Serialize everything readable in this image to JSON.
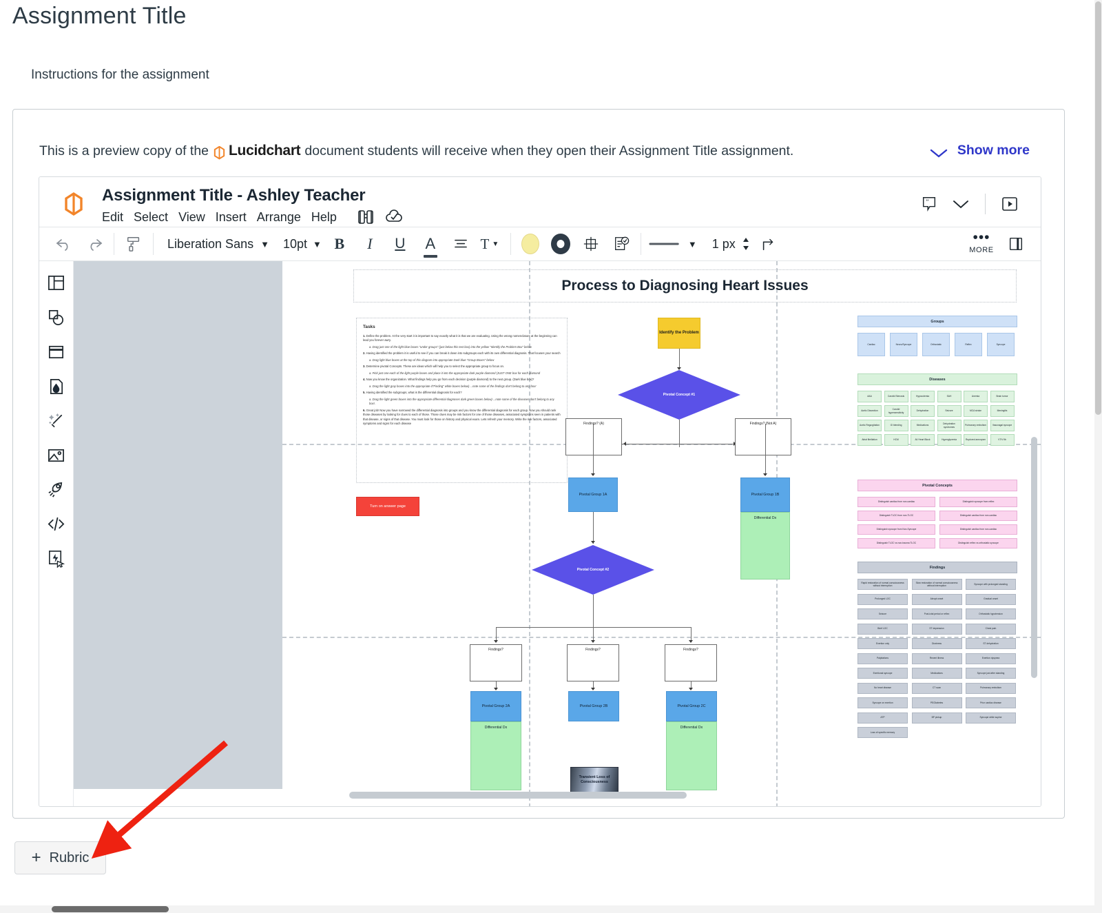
{
  "page": {
    "title": "Assignment Title",
    "instructions": "Instructions for the assignment"
  },
  "preview_banner": {
    "text_before": "This is a preview copy of the",
    "brand": "Lucidchart",
    "text_after": "document students will receive when they open their Assignment Title assignment.",
    "show_more_label": "Show more",
    "link_color": "#2f37c9"
  },
  "lucid_app": {
    "document_title": "Assignment Title - Ashley Teacher",
    "menus": [
      "Edit",
      "Select",
      "View",
      "Insert",
      "Arrange",
      "Help"
    ],
    "menu_icons": [
      "binoculars-icon",
      "cloud-check-icon"
    ],
    "header_right_icons": [
      "comment-icon",
      "chevron-down-icon",
      "present-icon"
    ],
    "toolbar": {
      "undo_icon": "undo-icon",
      "redo_icon": "redo-icon",
      "format_painter_icon": "paint-roller-icon",
      "font_family": "Liberation Sans",
      "font_size": "10pt",
      "bold": "B",
      "italic": "I",
      "underline": "U",
      "font_color": "A",
      "align_icon": "align-icon",
      "text_options": "T",
      "fill_swatch_color": "#f5eda0",
      "border_swatch_color": "#2f3b47",
      "shape_icon": "shape-bounds-icon",
      "notes_icon": "notes-check-icon",
      "line_style": "line-style-icon",
      "line_width": "1 px",
      "line_route_icon": "elbow-connector-icon",
      "more_dots": "•••",
      "more_label": "MORE",
      "panel_icon": "right-panel-icon"
    },
    "sidebar_icons": [
      "layout-panel-icon",
      "shapes-icon",
      "container-icon",
      "ink-document-icon",
      "magic-wand-icon",
      "image-icon",
      "rocket-icon",
      "code-icon",
      "quick-action-icon"
    ]
  },
  "diagram": {
    "title": "Process to Diagnosing Heart Issues",
    "tasks": {
      "heading": "Tasks",
      "items": [
        {
          "n": "1.",
          "text": "Define the problem.  At the very start it is important to say exactly what it is that we are evaluating. Using the wrong nomenclature at the beginning can lead you forever awry.",
          "sub": "a. Drag just one of the light blue boxes \"under groups\" (just below this text box) into the yellow \"Identify the Problem Box\" below"
        },
        {
          "n": "2.",
          "text": "Having identified the problem it is useful to see if you can break it down into subgroups each with its own differential diagnosis. That focuses your search",
          "sub": "a. Drag light blue boxes at the top of this diagram into appropriate  Dark blue \"Group Boxes\" below"
        },
        {
          "n": "3.",
          "text": "Determine pivotal Concepts.  These are ideas which will help you to select the appropriate group to focus on.",
          "sub": "a. Pick just one each of the light purple boxes and place it into the appropriate dark purple diamond (JUST ONE box for each diamond"
        },
        {
          "n": "4.",
          "text": "Now you know the organization. What findings help you go from each decision (purple diamond) to the next group. (Dark blue box)?",
          "sub": "a. Drag the light gray boxes into the appropriate d\"Finding\" white boxes below) ...note some of the findings don't belong to any box!"
        },
        {
          "n": "5.",
          "text": "Having identified the subgroups, what is the differential diagnosis for each?",
          "sub": "a. Drag the light green boxes into the appropriate differential diagnoses dark green boxes below) ...note some of the diseases don't belong to any box!."
        },
        {
          "n": "6.",
          "text": "Great job! Now you have narrowed the differential diagnosis into groups and you know the differential diagnosis for each group. Now you should rank those diseases by looking for clues to each of those. Those clues may be risk factors for one of those diseases, associated symptoms seen in patients with that disease, or signs of that disease. You must look for those on history and physical exam. Lets refresh your memory. Write the risk factors, associated symptoms and signs for each disease",
          "sub": ""
        }
      ]
    },
    "answer_button": "Turn on answer page",
    "nodes": {
      "identify": "Identify the Problem",
      "pivotal_concept_1": "Pivotal Concept #1",
      "pivotal_concept_2": "Pivotal Concept #2",
      "findings_yes": "Findings? (A)",
      "findings_no": "Findings? (Not A)",
      "findings_q": "Findings?",
      "group_1a": "Pivotal Group 1A",
      "group_1b": "Pivotal Group 1B",
      "group_2a": "Pivotal Group 2A",
      "group_2b": "Pivotal Group 2B",
      "group_2c": "Pivotal Group 2C",
      "differential": "Differential Dx",
      "transient": "Transient Loss of Consciousness"
    },
    "banks": [
      {
        "name": "groups",
        "header": "Groups",
        "color": "#cfe1f7",
        "cols": 5,
        "chips": [
          "Cardiac",
          "Neuro/Syncope",
          "Orthostatic",
          "Reflex",
          "Syncope"
        ]
      },
      {
        "name": "diseases",
        "header": "Diseases",
        "color": "#dff3e1",
        "cols": 6,
        "chips": [
          "AAA",
          "Carotid Stenosis",
          "Hypovolemia",
          "SAH",
          "Anemia",
          "Brain tumor",
          "Aortic Dissection",
          "Carotid hypersensitivity",
          "Dehydration",
          "Seizure",
          "MCA stroke",
          "Meningitis",
          "Aortic Regurgitation",
          "GI bleeding",
          "Medications",
          "Dehydration syndromes",
          "Pulmonary embolism",
          "Vasovagal syncope",
          "Atrial fibrillation",
          "HCM",
          "AV Heart Block",
          "Hyperglycemia",
          "Ruptured aneurysm",
          "VT/V fib"
        ]
      },
      {
        "name": "pivotal_concepts",
        "header": "Pivotal Concepts",
        "color": "#fbd5ee",
        "cols": 2,
        "chips": [
          "Distinguish cardiac from non-cardiac",
          "Distinguish syncope from reflex",
          "Distinguish TLOC from non-TLOC",
          "Distinguish cardiac from non-cardiac",
          "Distinguish syncope from Non-Syncope",
          "Distinguish cardiac from non-cardiac",
          "Distinguish TLOC vs non-trauma TLOC",
          "Distinguish reflex vs orthostatic syncope"
        ]
      },
      {
        "name": "findings",
        "header": "Findings",
        "color": "#c9cfd9",
        "cols": 3,
        "chips": [
          "Rapid restoration of normal consciousness without interruption",
          "Slow restoration of normal consciousness without interruption",
          "Syncope with prolonged standing",
          "Prolonged LOC",
          "Abrupt onset",
          "Gradual onset",
          "Seizure",
          "Post-ictal period or reflex",
          "Orthostatic hypotension",
          "Brief LOC",
          "ST depression",
          "Chest pain",
          "Exertion only",
          "Dizziness",
          "ST dehydration",
          "Palpitations",
          "Recent illness",
          "Exertion dyspnea",
          "Exertional syncope",
          "Medications",
          "Syncope just after standing",
          "No heart disease",
          "CT scan",
          "Pulmonary embolism",
          "Syncope on exertion",
          "PE/Diabetes",
          "Prior cardiac disease",
          "ATP",
          "BP pickup",
          "Syncope while supine",
          "Loss of specific memory"
        ]
      }
    ]
  },
  "footer": {
    "rubric_label": "Rubric",
    "rubric_plus": "+"
  },
  "annotation": {
    "arrow_color": "#ee2211",
    "points_to": "rubric-button"
  }
}
